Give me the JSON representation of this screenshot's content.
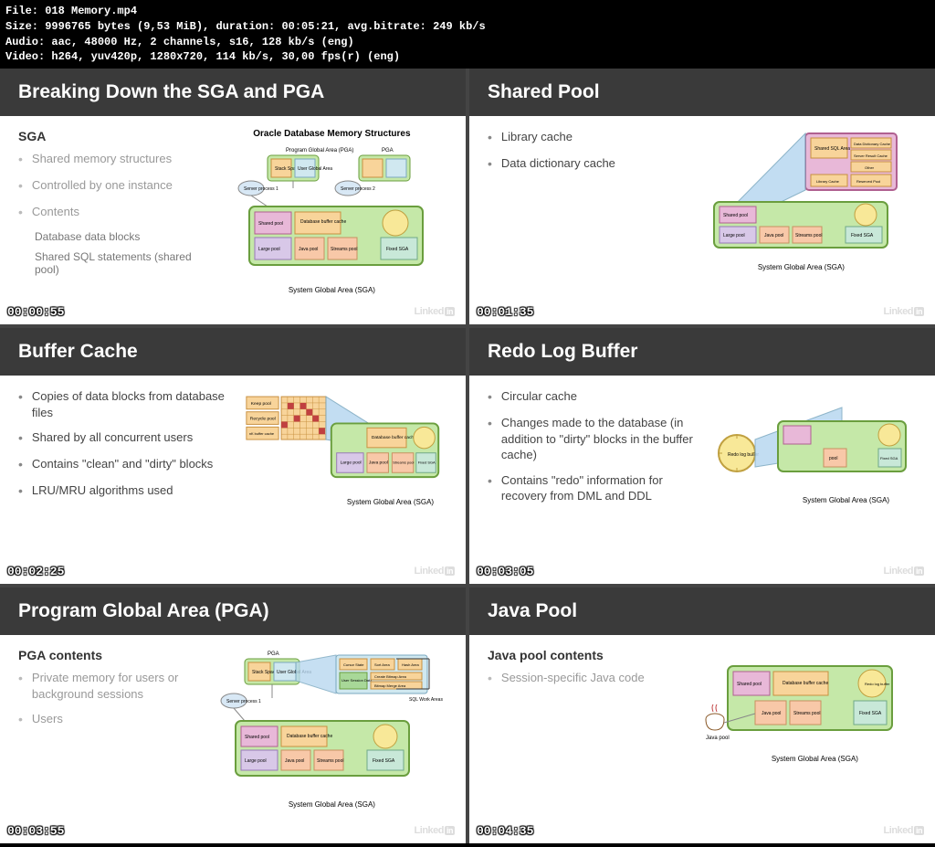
{
  "meta": {
    "file": "File: 018 Memory.mp4",
    "size": "Size: 9996765 bytes (9,53 MiB), duration: 00:05:21, avg.bitrate: 249 kb/s",
    "audio": "Audio: aac, 48000 Hz, 2 channels, s16, 128 kb/s (eng)",
    "video": "Video: h264, yuv420p, 1280x720, 114 kb/s, 30,00 fps(r) (eng)"
  },
  "slides": [
    {
      "title": "Breaking Down the SGA and PGA",
      "subheading": "SGA",
      "timestamp": "00:00:55",
      "bullets_style": "light",
      "bullets": [
        "Shared memory structures",
        "Controlled by one instance",
        "Contents"
      ],
      "sublist": [
        "Database data blocks",
        "Shared SQL statements (shared pool)"
      ],
      "diagram": {
        "title": "Oracle Database Memory Structures",
        "caption": "System Global Area (SGA)",
        "pga_label": "Program Global Area (PGA)",
        "pga2_label": "PGA",
        "server1": "Server process 1",
        "server2": "Server process 2",
        "boxes": {
          "stack": "Stack Space",
          "user": "User Global Area",
          "shared": "Shared pool",
          "buffer": "Database buffer cache",
          "large": "Large pool",
          "java": "Java pool",
          "streams": "Streams pool",
          "fixed": "Fixed SGA"
        }
      }
    },
    {
      "title": "Shared Pool",
      "timestamp": "00:01:35",
      "bullets": [
        "Library cache",
        "Data dictionary cache"
      ],
      "diagram": {
        "caption": "System Global Area (SGA)",
        "boxes": {
          "shared_sql": "Shared SQL Area",
          "data_dict": "Data Dictionary Cache",
          "server_result": "Server Result Cache",
          "other": "Other",
          "library": "Library Cache",
          "reserved": "Reserved Pool",
          "shared": "Shared pool",
          "large": "Large pool",
          "java": "Java pool",
          "streams": "Streams pool",
          "fixed": "Fixed SGA"
        }
      }
    },
    {
      "title": "Buffer Cache",
      "timestamp": "00:02:25",
      "text_wide": true,
      "bullets": [
        "Copies of data blocks from database files",
        "Shared by all concurrent users",
        "Contains \"clean\" and \"dirty\" blocks",
        "LRU/MRU algorithms used"
      ],
      "diagram": {
        "caption": "System Global Area (SGA)",
        "boxes": {
          "keep": "Keep pool",
          "recycle": "Recycle pool",
          "nk": "nK buffer cache",
          "buffer": "Database buffer cache",
          "large": "Large pool",
          "java": "Java pool",
          "streams": "Streams pool",
          "fixed": "Fixed SGA"
        }
      }
    },
    {
      "title": "Redo Log Buffer",
      "timestamp": "00:03:05",
      "text_wide": true,
      "bullets": [
        "Circular cache",
        "Changes made to the database (in addition to \"dirty\" blocks in the buffer cache)",
        "Contains \"redo\" information for recovery from DML and DDL"
      ],
      "diagram": {
        "caption": "System Global Area (SGA)",
        "boxes": {
          "redo": "Redo log buffer",
          "pool": "pool",
          "fixed": "Fixed SGA"
        }
      }
    },
    {
      "title": "Program Global Area (PGA)",
      "subheading": "PGA contents",
      "timestamp": "00:03:55",
      "bullets_style": "light",
      "bullets": [
        "Private memory for users or background sessions",
        "Users"
      ],
      "diagram": {
        "caption": "System Global Area (SGA)",
        "pga_label": "PGA",
        "sql_label": "SQL Work Areas",
        "server1": "Server process 1",
        "boxes": {
          "stack": "Stack Space",
          "user": "User Global Area",
          "cursor": "Cursor State",
          "sort": "Sort Area",
          "hash": "Hash Area",
          "session": "User Session Data",
          "bitmap1": "Create Bitmap Area",
          "bitmap2": "Bitmap Merge Area",
          "shared": "Shared pool",
          "buffer": "Database buffer cache",
          "large": "Large pool",
          "java": "Java pool",
          "streams": "Streams pool",
          "fixed": "Fixed SGA"
        }
      }
    },
    {
      "title": "Java Pool",
      "subheading": "Java pool contents",
      "timestamp": "00:04:35",
      "bullets_style": "light",
      "bullets": [
        "Session-specific Java code"
      ],
      "diagram": {
        "caption": "System Global Area (SGA)",
        "javapool_label": "Java pool",
        "boxes": {
          "shared": "Shared pool",
          "buffer": "Database buffer cache",
          "redo": "Redo log buffer",
          "java": "Java pool",
          "streams": "Streams pool",
          "fixed": "Fixed SGA"
        }
      }
    }
  ]
}
